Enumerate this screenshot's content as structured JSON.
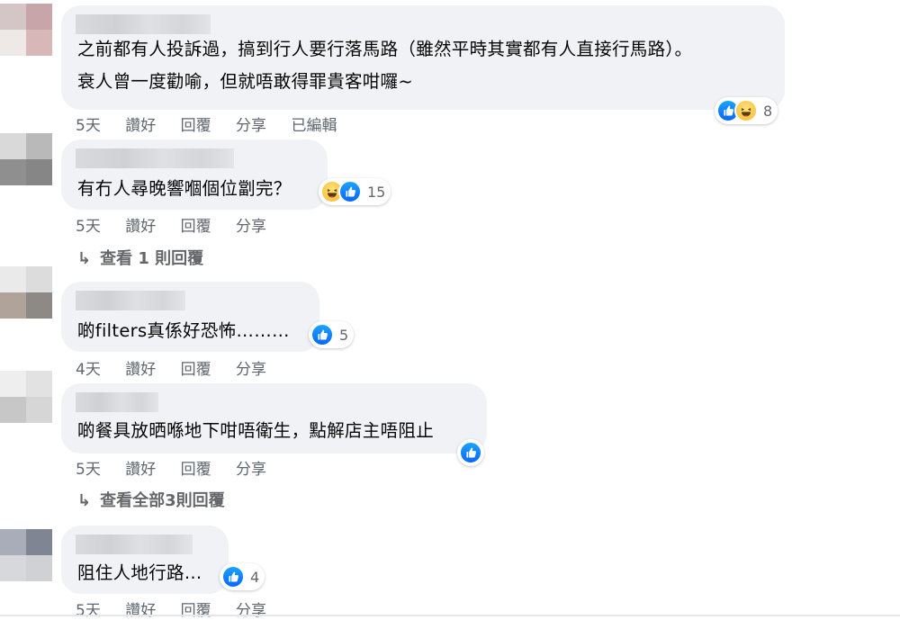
{
  "comments": [
    {
      "lines": [
        "之前都有人投訴過，搞到行人要行落馬路（雖然平時其實都有人直接行馬路）。",
        "衰人曾一度勸喻，但就唔敢得罪貴客咁囉~"
      ],
      "time": "5天",
      "like_label": "讚好",
      "reply_label": "回覆",
      "share_label": "分享",
      "edited_label": "已編輯",
      "reactions": [
        "like",
        "haha"
      ],
      "count": "8"
    },
    {
      "lines": [
        "有冇人尋晚響嗰個位劏完？"
      ],
      "time": "5天",
      "like_label": "讚好",
      "reply_label": "回覆",
      "share_label": "分享",
      "reactions": [
        "haha",
        "like"
      ],
      "count": "15",
      "view_replies": "查看 1 則回覆"
    },
    {
      "lines": [
        "啲filters真係好恐怖………"
      ],
      "time": "4天",
      "like_label": "讚好",
      "reply_label": "回覆",
      "share_label": "分享",
      "reactions": [
        "like"
      ],
      "count": "5"
    },
    {
      "lines": [
        "啲餐具放晒喺地下咁唔衛生，點解店主唔阻止"
      ],
      "time": "5天",
      "like_label": "讚好",
      "reply_label": "回覆",
      "share_label": "分享",
      "reactions": [
        "like"
      ],
      "count": "",
      "view_replies": "查看全部3則回覆"
    },
    {
      "lines": [
        "阻住人地行路…"
      ],
      "time": "5天",
      "like_label": "讚好",
      "reply_label": "回覆",
      "share_label": "分享",
      "reactions": [
        "like"
      ],
      "count": "4"
    }
  ],
  "icons": {
    "reply_arrow": "reply-arrow-icon",
    "like": "like-icon",
    "haha": "haha-icon"
  },
  "colors": {
    "bubble": "#f0f2f5",
    "meta_text": "#65676b",
    "like_blue": "#0866ff"
  }
}
